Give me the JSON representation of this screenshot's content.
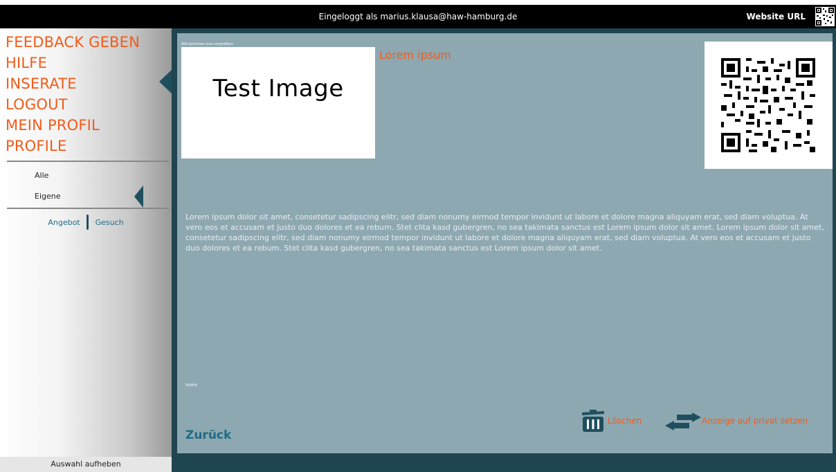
{
  "header": {
    "login_text": "Eingeloggt als marius.klausa@haw-hamburg.de",
    "website_url_label": "Website URL",
    "qr_icon": "qr-code-icon"
  },
  "sidebar": {
    "menu": [
      {
        "label": "FEEDBACK GEBEN"
      },
      {
        "label": "HILFE"
      },
      {
        "label": "INSERATE"
      },
      {
        "label": "LOGOUT"
      },
      {
        "label": "MEIN PROFIL"
      },
      {
        "label": "PROFILE"
      }
    ],
    "active_menu": "INSERATE",
    "filters": [
      {
        "label": "Alle"
      },
      {
        "label": "Eigene"
      }
    ],
    "active_filter": "Eigene",
    "types": {
      "angebot": "Angebot",
      "gesuch": "Gesuch"
    },
    "deselect_label": "Auswahl aufheben"
  },
  "ad": {
    "image_hint": "Bild berühren zum vergrößern",
    "image_text": "Test Image",
    "title": "Lorem ipsum",
    "description": "Lorem ipsum dolor sit amet, consetetur sadipscing elitr, sed diam nonumy eirmod tempor invidunt ut labore et dolore magna aliquyam erat, sed diam voluptua. At vero eos et accusam et justo duo dolores et ea rebum. Stet clita kasd gubergren, no sea takimata sanctus est Lorem ipsum dolor sit amet. Lorem ipsum dolor sit amet, consetetur sadipscing elitr, sed diam nonumy eirmod tempor invidunt ut labore et dolore magna aliquyam erat, sed diam voluptua. At vero eos et accusam et justo duo dolores et ea rebum. Stet clita kasd gubergren, no sea takimata sanctus est Lorem ipsum dolor sit amet.",
    "small_label": "lorem"
  },
  "actions": {
    "back_label": "Zurück",
    "delete_label": "Löschen",
    "delete_icon": "trash-icon",
    "private_label": "Anzeige auf privat setzen",
    "private_icon": "swap-arrows-icon"
  },
  "colors": {
    "accent": "#f25b18",
    "dark_teal": "#1f4f5f",
    "content_bg": "#8ea8b1",
    "link_blue": "#1e6b88"
  }
}
